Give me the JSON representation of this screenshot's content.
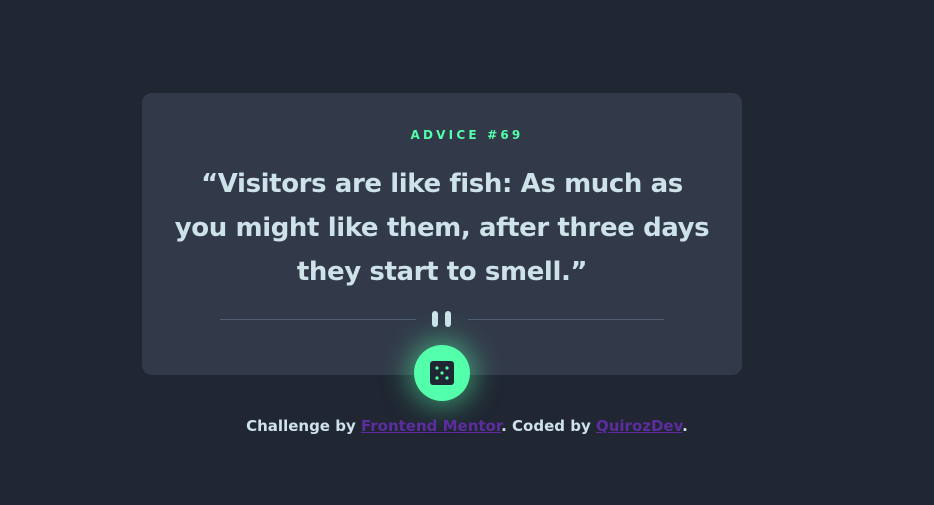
{
  "card": {
    "advice_label": "ADVICE #69",
    "quote": "“Visitors are like fish: As much as you might like them, after three days they start to smell.”"
  },
  "dice_button": {
    "icon": "dice-icon"
  },
  "footer": {
    "prefix": "Challenge by ",
    "link1": "Frontend Mentor",
    "middle": ". Coded by ",
    "link2": "QuirozDev",
    "suffix": "."
  },
  "colors": {
    "background": "#202632",
    "card": "#323a49",
    "accent": "#53ffaa",
    "text": "#cee3e9",
    "link": "#5d2da0"
  }
}
